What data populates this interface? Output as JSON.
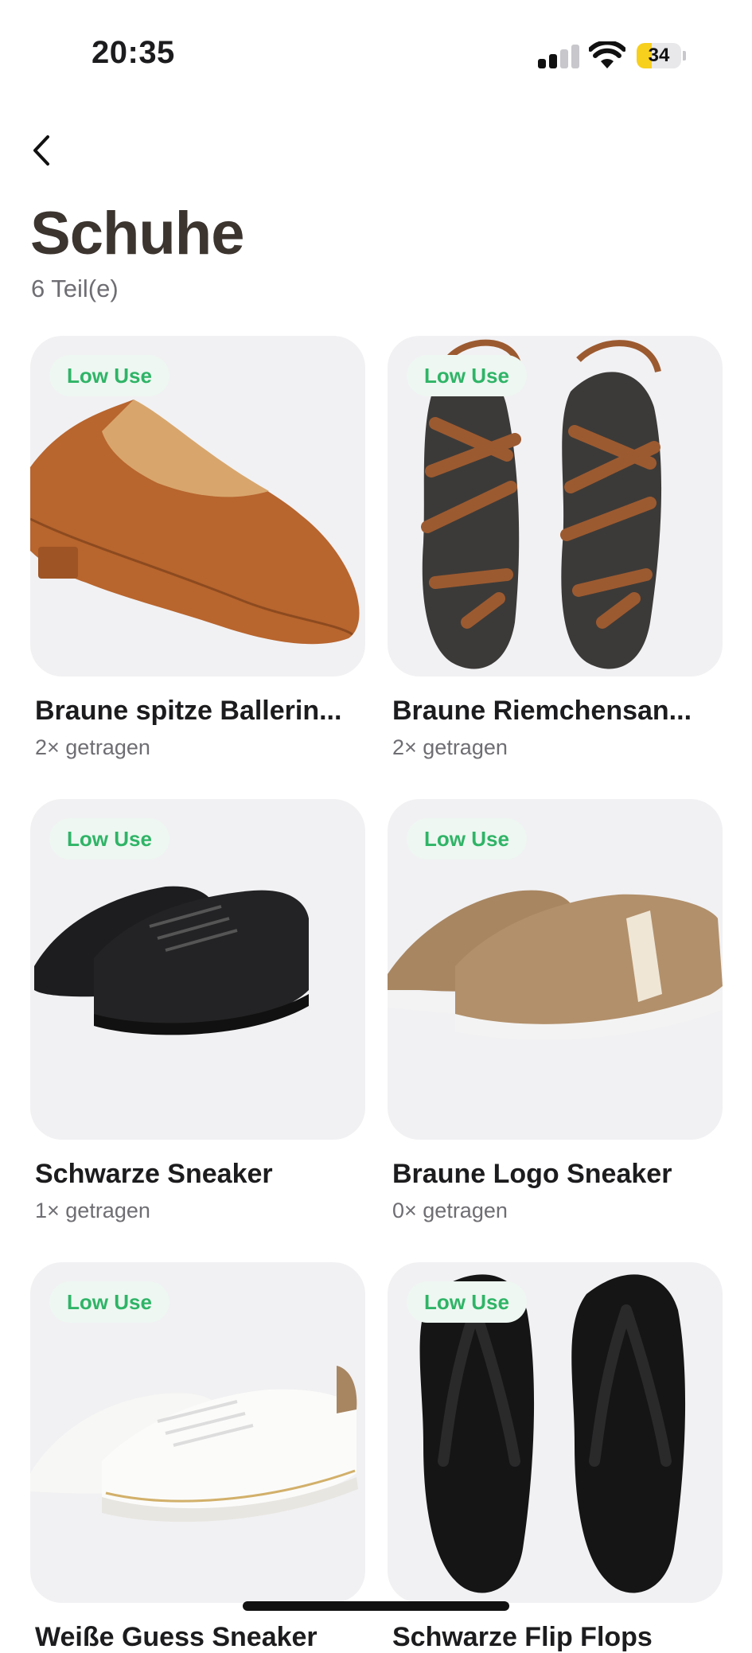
{
  "status_bar": {
    "time": "20:35",
    "battery": "34",
    "battery_level": 0.34
  },
  "header": {
    "title": "Schuhe",
    "count": "6 Teil(e)"
  },
  "items": [
    {
      "name": "Braune spitze Ballerin...",
      "worn": "2× getragen",
      "badge": "Low Use",
      "image": "brown-flat-shoe"
    },
    {
      "name": "Braune Riemchensan...",
      "worn": "2× getragen",
      "badge": "Low Use",
      "image": "brown-strappy-sandals"
    },
    {
      "name": "Schwarze Sneaker",
      "worn": "1× getragen",
      "badge": "Low Use",
      "image": "black-sneakers"
    },
    {
      "name": "Braune Logo Sneaker",
      "worn": "0× getragen",
      "badge": "Low Use",
      "image": "brown-logo-sneakers"
    },
    {
      "name": "Weiße Guess Sneaker",
      "worn": "",
      "badge": "Low Use",
      "image": "white-sneakers"
    },
    {
      "name": "Schwarze Flip Flops",
      "worn": "",
      "badge": "Low Use",
      "image": "black-flip-flops"
    }
  ],
  "colors": {
    "badge_text": "#2fb467",
    "badge_bg": "#eef7f1",
    "card_bg": "#f1f1f3",
    "title": "#3b342f"
  }
}
